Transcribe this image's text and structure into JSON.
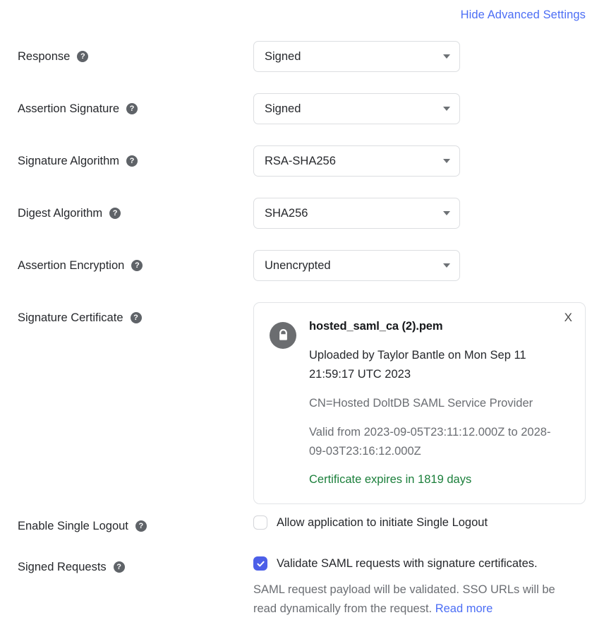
{
  "header": {
    "advanced_toggle_label": "Hide Advanced Settings"
  },
  "colors": {
    "link_blue": "#4c6ef5",
    "checkbox_blue": "#4c5fe8",
    "expiry_green": "#1b7f3b",
    "help_icon_gray": "#5f6368",
    "lock_gray": "#6b6d70",
    "border_gray": "#dcdee1"
  },
  "fields": {
    "response": {
      "label": "Response",
      "help_icon": "question-mark-icon",
      "value": "Signed"
    },
    "assertion_signature": {
      "label": "Assertion Signature",
      "help_icon": "question-mark-icon",
      "value": "Signed"
    },
    "signature_algorithm": {
      "label": "Signature Algorithm",
      "help_icon": "question-mark-icon",
      "value": "RSA-SHA256"
    },
    "digest_algorithm": {
      "label": "Digest Algorithm",
      "help_icon": "question-mark-icon",
      "value": "SHA256"
    },
    "assertion_encryption": {
      "label": "Assertion Encryption",
      "help_icon": "question-mark-icon",
      "value": "Unencrypted"
    },
    "signature_certificate": {
      "label": "Signature Certificate",
      "help_icon": "question-mark-icon"
    },
    "enable_single_logout": {
      "label": "Enable Single Logout",
      "help_icon": "question-mark-icon",
      "checkbox_label": "Allow application to initiate Single Logout",
      "checked": false
    },
    "signed_requests": {
      "label": "Signed Requests",
      "help_icon": "question-mark-icon",
      "checkbox_label": "Validate SAML requests with signature certificates.",
      "checked": true,
      "note_text": "SAML request payload will be validated. SSO URLs will be read dynamically from the request. ",
      "note_link": "Read more"
    }
  },
  "certificate_card": {
    "icon": "lock-icon",
    "close_label": "X",
    "filename": "hosted_saml_ca (2).pem",
    "uploaded_by": "Uploaded by Taylor Bantle on Mon Sep 11 21:59:17 UTC 2023",
    "subject_line": "CN=Hosted DoltDB SAML Service Provider",
    "validity_line": "Valid from 2023-09-05T23:11:12.000Z to 2028-09-03T23:16:12.000Z",
    "expiry_status": "Certificate expires in 1819 days"
  }
}
